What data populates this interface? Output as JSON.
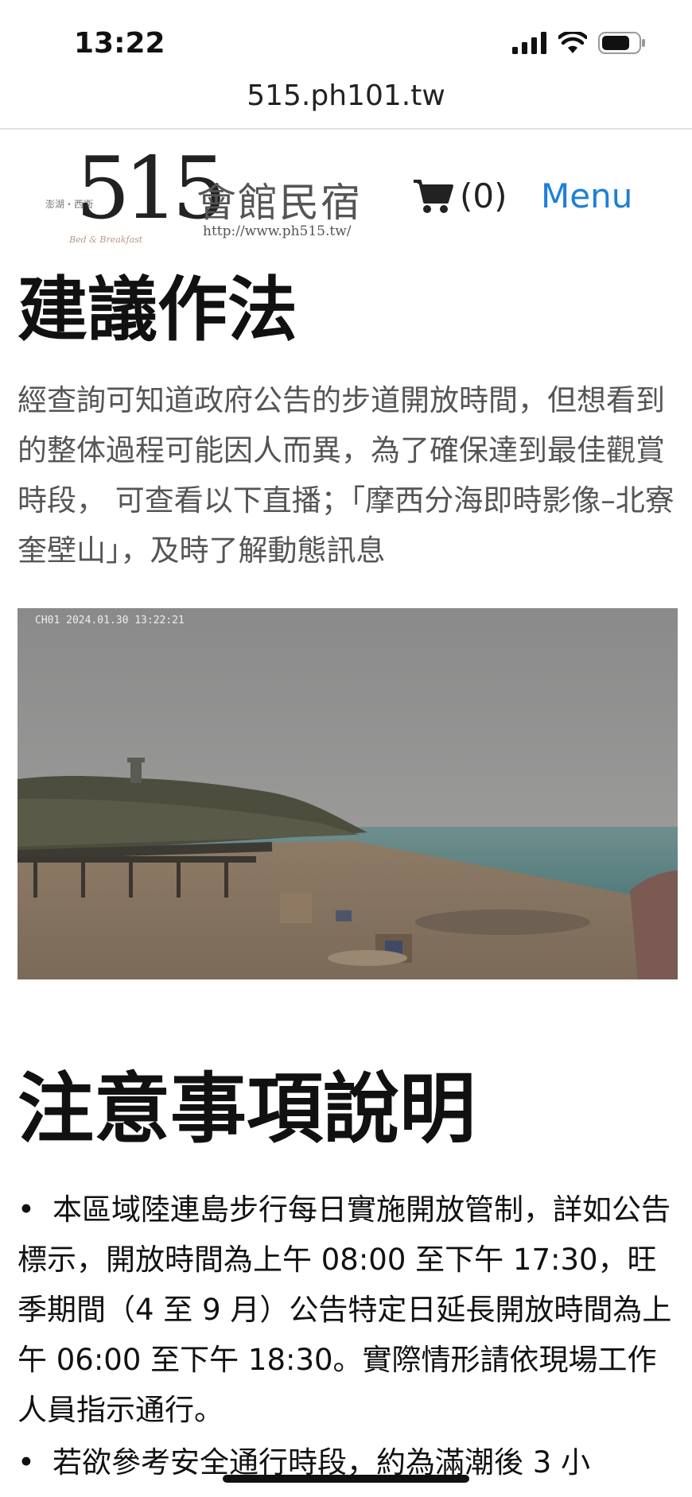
{
  "status": {
    "time": "13:22"
  },
  "browser": {
    "url": "515.ph101.tw"
  },
  "header": {
    "logo_number": "515",
    "logo_small_left": "澎湖・西衛",
    "logo_small_sub": "Bed & Breakfast",
    "logo_brand": "會館民宿",
    "logo_site": "http://www.ph515.tw/",
    "cart_count": "(0)",
    "menu_label": "Menu"
  },
  "section1": {
    "title": "建議作法",
    "paragraph": "經查詢可知道政府公告的步道開放時間，但想看到的整体過程可能因人而異，為了確保達到最佳觀賞時段， 可查看以下直播；「摩西分海即時影像–北寮奎壁山」，及時了解動態訊息"
  },
  "camera": {
    "timestamp": "CH01 2024.01.30 13:22:21"
  },
  "section2": {
    "title": "注意事項說明",
    "items": [
      "本區域陸連島步行每日實施開放管制，詳如公告標示，開放時間為上午 08:00 至下午 17:30，旺季期間（4 至 9 月）公告特定日延長開放時間為上午 06:00 至下午 18:30。實際情形請依現場工作人員指示通行。",
      "若欲參考安全通行時段，約為滿潮後 3 小"
    ]
  },
  "icons": {
    "signal": "signal-icon",
    "wifi": "wifi-icon",
    "battery": "battery-icon",
    "cart": "cart-icon"
  },
  "colors": {
    "menu_link": "#1e7fd6",
    "paragraph_text": "#555555"
  }
}
